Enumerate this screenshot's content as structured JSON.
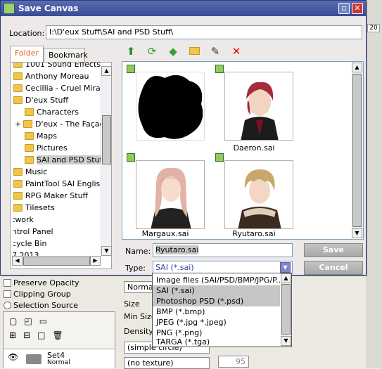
{
  "dialog": {
    "title": "Save Canvas",
    "location_label": "Location:",
    "location_value": "I:\\D'eux Stuff\\SAI and PSD Stuff\\",
    "tabs": [
      "Folder",
      "Bookmark"
    ],
    "tree_items": [
      "1001 Sound Effects",
      "Anthony Moreau",
      "Cecillia - Cruel Miracle",
      "D'eux Stuff",
      "Characters",
      "D'eux - The Façad",
      "Maps",
      "Pictures",
      "SAI and PSD Stuff",
      "Music",
      "PaintTool SAI English",
      "RPG Maker Stuff",
      "Tilesets",
      "twork",
      "ntrol Panel",
      "cycle Bin",
      "7 2013"
    ],
    "tree_expander": "+",
    "files": [
      {
        "name": ""
      },
      {
        "name": "Daeron.sai"
      },
      {
        "name": "Margaux.sai"
      },
      {
        "name": "Ryutaro.sai"
      }
    ],
    "name_label": "Name:",
    "name_value": "Ryutaro.sai",
    "type_label": "Type:",
    "type_value": "SAI (*.sai)",
    "save_button": "Save",
    "cancel_button": "Cancel",
    "type_options": [
      "Image files (SAI/PSD/BMP/JPG/P...",
      "SAI (*.sai)",
      "Photoshop PSD (*.psd)",
      "BMP (*.bmp)",
      "JPEG (*.jpg *.jpeg)",
      "PNG (*.png)",
      "TARGA (*.tga)"
    ],
    "toolbar_icons": [
      "up-folder-icon",
      "refresh-icon",
      "tag-icon",
      "new-folder-icon",
      "rename-icon",
      "delete-icon"
    ]
  },
  "background": {
    "preserve_opacity": "Preserve Opacity",
    "clipping_group": "Clipping Group",
    "selection_source": "Selection Source",
    "layer_name": "Set4",
    "layer_mode": "Normal",
    "blend_mode": "Normal",
    "size_label": "Size",
    "min_size_label": "Min Size",
    "density_label": "Density",
    "shape_select": "(simple circle)",
    "texture_select": "(no texture)",
    "side_number": "20",
    "texture_value": "95"
  }
}
